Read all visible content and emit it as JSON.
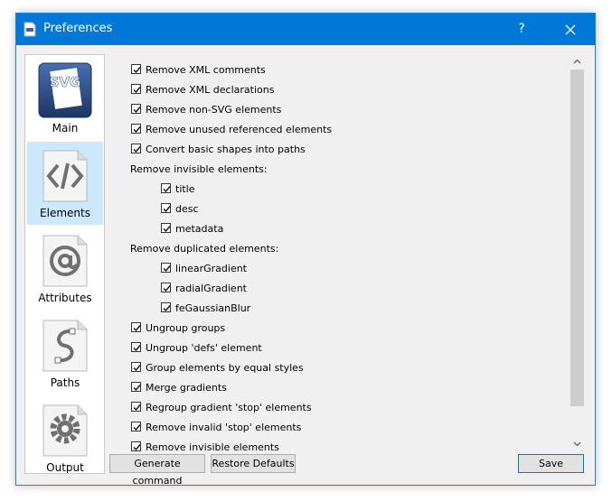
{
  "window": {
    "title": "Preferences",
    "help_label": "?",
    "close_label": "✕"
  },
  "sidebar": {
    "items": [
      {
        "label": "Main",
        "icon": "svg-cleaner-logo-icon",
        "logo_text_1": "SVG",
        "logo_text_2": "CLEANER",
        "selected": false
      },
      {
        "label": "Elements",
        "icon": "code-document-icon",
        "selected": true
      },
      {
        "label": "Attributes",
        "icon": "at-document-icon",
        "selected": false
      },
      {
        "label": "Paths",
        "icon": "path-document-icon",
        "selected": false
      },
      {
        "label": "Output",
        "icon": "gear-document-icon",
        "selected": false
      }
    ]
  },
  "options": [
    {
      "label": "Remove XML comments",
      "checked": true,
      "indent": 0,
      "checkbox": true
    },
    {
      "label": "Remove XML declarations",
      "checked": true,
      "indent": 0,
      "checkbox": true
    },
    {
      "label": "Remove non-SVG elements",
      "checked": true,
      "indent": 0,
      "checkbox": true
    },
    {
      "label": "Remove unused referenced elements",
      "checked": true,
      "indent": 0,
      "checkbox": true
    },
    {
      "label": "Convert basic shapes into paths",
      "checked": true,
      "indent": 0,
      "checkbox": true
    },
    {
      "label": "Remove invisible elements:",
      "checked": false,
      "indent": 0,
      "checkbox": false
    },
    {
      "label": "title",
      "checked": true,
      "indent": 1,
      "checkbox": true
    },
    {
      "label": "desc",
      "checked": true,
      "indent": 1,
      "checkbox": true
    },
    {
      "label": "metadata",
      "checked": true,
      "indent": 1,
      "checkbox": true
    },
    {
      "label": "Remove duplicated elements:",
      "checked": false,
      "indent": 0,
      "checkbox": false
    },
    {
      "label": "linearGradient",
      "checked": true,
      "indent": 1,
      "checkbox": true
    },
    {
      "label": "radialGradient",
      "checked": true,
      "indent": 1,
      "checkbox": true
    },
    {
      "label": "feGaussianBlur",
      "checked": true,
      "indent": 1,
      "checkbox": true
    },
    {
      "label": "Ungroup groups",
      "checked": true,
      "indent": 0,
      "checkbox": true
    },
    {
      "label": "Ungroup 'defs' element",
      "checked": true,
      "indent": 0,
      "checkbox": true
    },
    {
      "label": "Group elements by equal styles",
      "checked": true,
      "indent": 0,
      "checkbox": true
    },
    {
      "label": "Merge gradients",
      "checked": true,
      "indent": 0,
      "checkbox": true
    },
    {
      "label": "Regroup gradient 'stop' elements",
      "checked": true,
      "indent": 0,
      "checkbox": true
    },
    {
      "label": "Remove invalid 'stop' elements",
      "checked": true,
      "indent": 0,
      "checkbox": true
    },
    {
      "label": "Remove invisible elements",
      "checked": true,
      "indent": 0,
      "checkbox": true
    }
  ],
  "buttons": {
    "generate": "Generate command",
    "restore": "Restore Defaults",
    "save": "Save"
  },
  "colors": {
    "titlebar": "#0078d7",
    "selection": "#cce8ff"
  }
}
